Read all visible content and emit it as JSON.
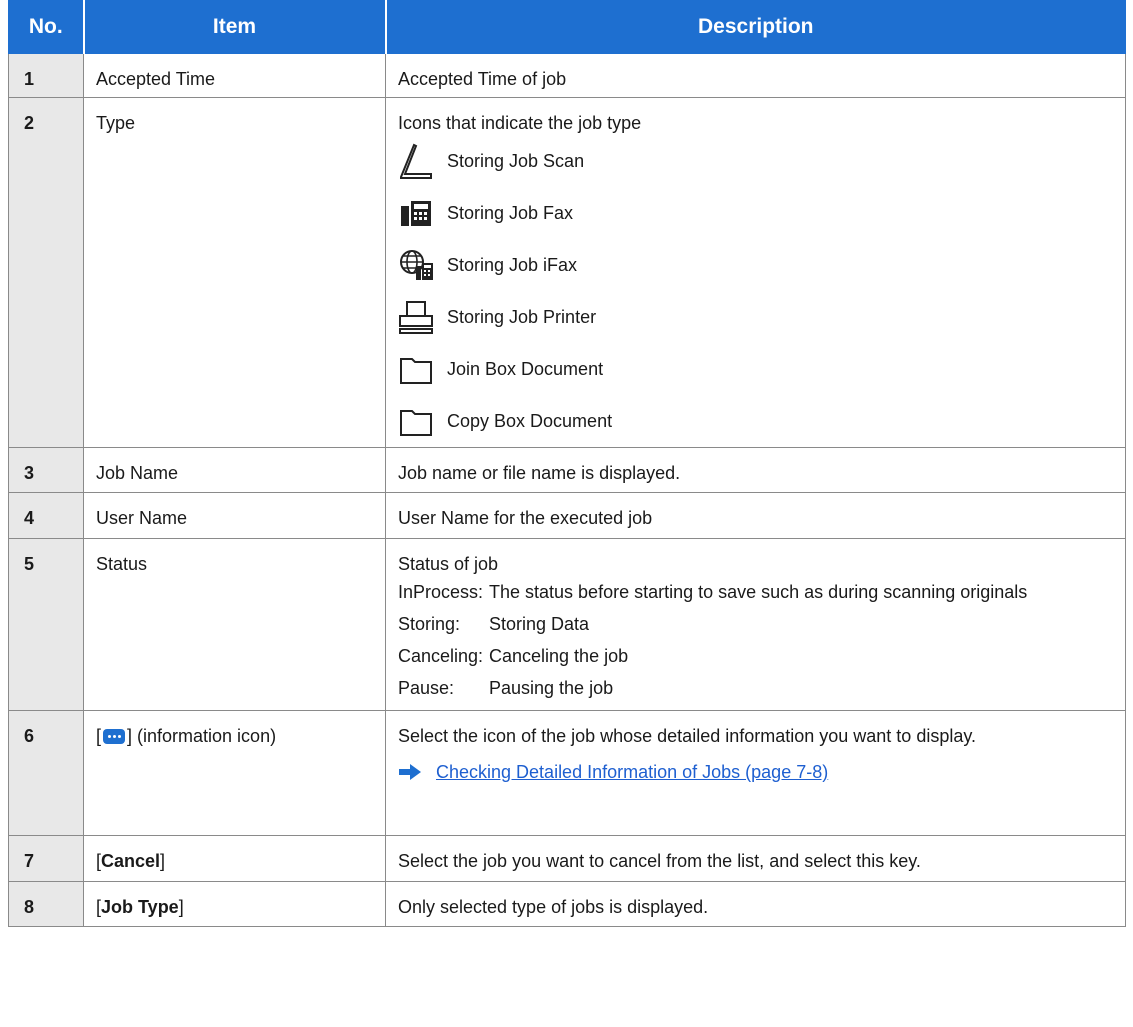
{
  "header": {
    "no": "No.",
    "item": "Item",
    "description": "Description"
  },
  "rows": {
    "r1": {
      "no": "1",
      "item": "Accepted Time",
      "desc": "Accepted Time of job"
    },
    "r2": {
      "no": "2",
      "item": "Type",
      "desc": "Icons that indicate the job type",
      "types": [
        {
          "icon": "scan-icon",
          "label": "Storing Job Scan"
        },
        {
          "icon": "fax-icon",
          "label": "Storing Job Fax"
        },
        {
          "icon": "ifax-icon",
          "label": "Storing Job iFax"
        },
        {
          "icon": "printer-icon",
          "label": "Storing Job Printer"
        },
        {
          "icon": "folder-icon",
          "label": "Join Box Document"
        },
        {
          "icon": "folder-icon",
          "label": "Copy Box Document"
        }
      ]
    },
    "r3": {
      "no": "3",
      "item": "Job Name",
      "desc": "Job name or file name is displayed."
    },
    "r4": {
      "no": "4",
      "item": "User Name",
      "desc": "User Name for the executed job"
    },
    "r5": {
      "no": "5",
      "item": "Status",
      "desc": "Status of job",
      "statuses": [
        {
          "term": "InProcess:",
          "def": "The status before starting to save such as during scanning originals"
        },
        {
          "term": "Storing:",
          "def": "Storing Data"
        },
        {
          "term": "Canceling:",
          "def": "Canceling the job"
        },
        {
          "term": "Pause:",
          "def": "Pausing the job"
        }
      ]
    },
    "r6": {
      "no": "6",
      "item_open": "[",
      "item_close": "] (information icon)",
      "desc": "Select the icon of the job whose detailed information you want to display.",
      "link": "Checking Detailed Information of Jobs (page 7-8)"
    },
    "r7": {
      "no": "7",
      "item_open": "[",
      "item_bold": "Cancel",
      "item_close": "]",
      "desc": "Select the job you want to cancel from the list, and select this key."
    },
    "r8": {
      "no": "8",
      "item_open": "[",
      "item_bold": "Job Type",
      "item_close": "]",
      "desc": "Only selected type of jobs is displayed."
    }
  },
  "colors": {
    "header_bg": "#1e6fd0",
    "no_col_bg": "#e8e8e8",
    "link": "#1e5fd0"
  }
}
